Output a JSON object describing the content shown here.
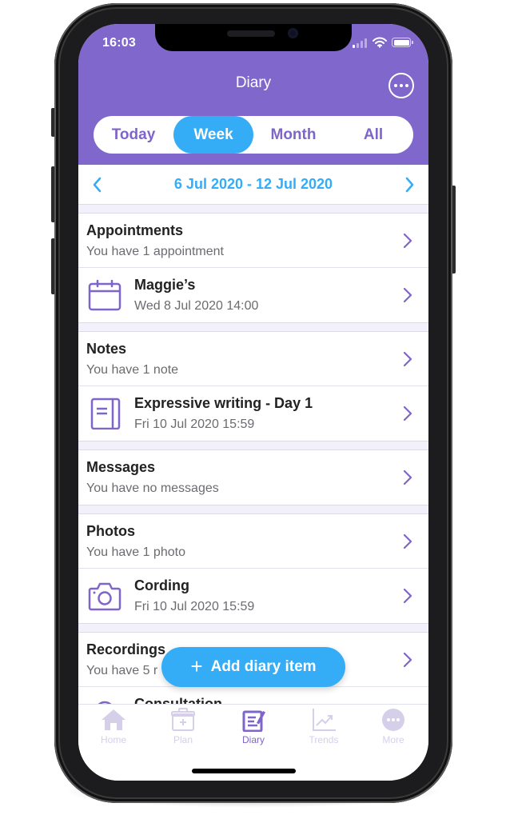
{
  "status_bar": {
    "time": "16:03",
    "icons": [
      "cellular-signal-icon",
      "wifi-icon",
      "battery-icon"
    ]
  },
  "header": {
    "title": "Diary",
    "more_icon": "ellipsis-circle-icon"
  },
  "period_tabs": {
    "items": [
      {
        "label": "Today",
        "active": false
      },
      {
        "label": "Week",
        "active": true
      },
      {
        "label": "Month",
        "active": false
      },
      {
        "label": "All",
        "active": false
      }
    ]
  },
  "date_range": {
    "label": "6 Jul 2020 - 12 Jul 2020",
    "prev_icon": "chevron-left-icon",
    "next_icon": "chevron-right-icon"
  },
  "sections": [
    {
      "title": "Appointments",
      "subtitle": "You have 1 appointment",
      "items": [
        {
          "icon": "calendar-icon",
          "title": "Maggie’s",
          "subtitle": "Wed 8 Jul 2020 14:00"
        }
      ]
    },
    {
      "title": "Notes",
      "subtitle": "You have 1 note",
      "items": [
        {
          "icon": "notebook-icon",
          "title": "Expressive writing - Day 1",
          "subtitle": "Fri 10 Jul 2020 15:59"
        }
      ]
    },
    {
      "title": "Messages",
      "subtitle": "You have no messages",
      "items": []
    },
    {
      "title": "Photos",
      "subtitle": "You have 1 photo",
      "items": [
        {
          "icon": "camera-icon",
          "title": "Cording",
          "subtitle": "Fri 10 Jul 2020 15:59"
        }
      ]
    },
    {
      "title": "Recordings",
      "subtitle": "You have 5 r",
      "items": [
        {
          "icon": "microphone-icon",
          "title": "Consultation",
          "subtitle": ""
        }
      ]
    }
  ],
  "fab": {
    "label": "Add diary item",
    "icon": "plus-icon"
  },
  "tab_bar": {
    "items": [
      {
        "label": "Home",
        "icon": "home-icon",
        "active": false
      },
      {
        "label": "Plan",
        "icon": "medical-kit-icon",
        "active": false
      },
      {
        "label": "Diary",
        "icon": "diary-edit-icon",
        "active": true
      },
      {
        "label": "Trends",
        "icon": "trend-chart-icon",
        "active": false
      },
      {
        "label": "More",
        "icon": "more-circle-icon",
        "active": false
      }
    ]
  },
  "colors": {
    "brand_purple": "#8067cc",
    "accent_blue": "#35acf6",
    "icon_purple": "#7f64c9",
    "inactive_tab": "#d5cfea",
    "list_background": "#f1f0fb"
  }
}
